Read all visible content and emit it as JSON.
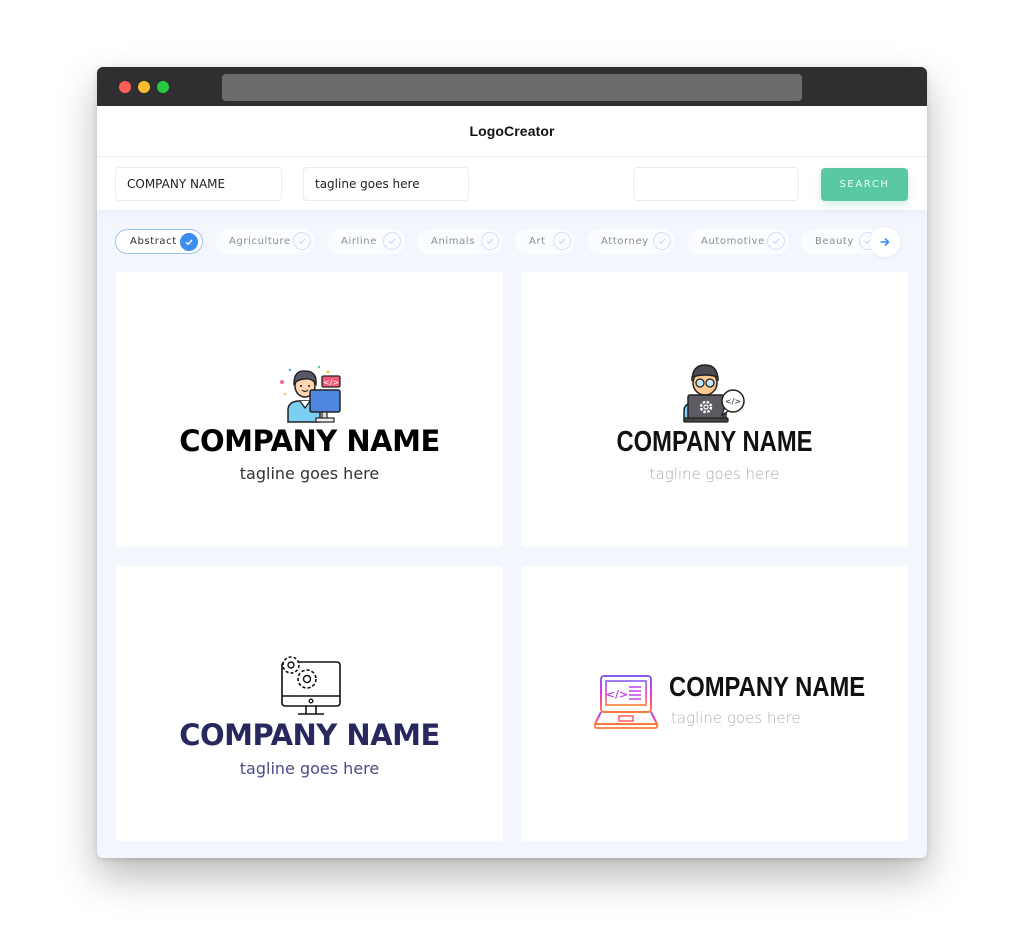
{
  "browser": {
    "controls": [
      "close",
      "minimize",
      "maximize"
    ]
  },
  "app": {
    "title": "LogoCreator"
  },
  "search": {
    "company_value": "COMPANY NAME",
    "tagline_value": "tagline goes here",
    "query_value": "",
    "button_label": "SEARCH",
    "accent_color": "#5ac8a0"
  },
  "categories": {
    "items": [
      {
        "label": "Abstract",
        "selected": true
      },
      {
        "label": "Agriculture",
        "selected": false
      },
      {
        "label": "Airline",
        "selected": false
      },
      {
        "label": "Animals",
        "selected": false
      },
      {
        "label": "Art",
        "selected": false
      },
      {
        "label": "Attorney",
        "selected": false
      },
      {
        "label": "Automotive",
        "selected": false
      },
      {
        "label": "Beauty",
        "selected": false
      }
    ],
    "next_icon": "arrow-right-icon",
    "selected_color": "#3a8ef0"
  },
  "logos": [
    {
      "icon": "developer-at-computer-icon",
      "company": "COMPANY NAME",
      "tagline": "tagline goes here",
      "name_color": "#000000"
    },
    {
      "icon": "hacker-with-laptop-icon",
      "company": "COMPANY NAME",
      "tagline": "tagline goes here",
      "name_color": "#111111"
    },
    {
      "icon": "monitor-with-gears-icon",
      "company": "COMPANY NAME",
      "tagline": "tagline goes here",
      "name_color": "#27285e"
    },
    {
      "icon": "laptop-code-gradient-icon",
      "company": "COMPANY NAME",
      "tagline": "tagline goes here",
      "name_color": "#111111"
    }
  ]
}
